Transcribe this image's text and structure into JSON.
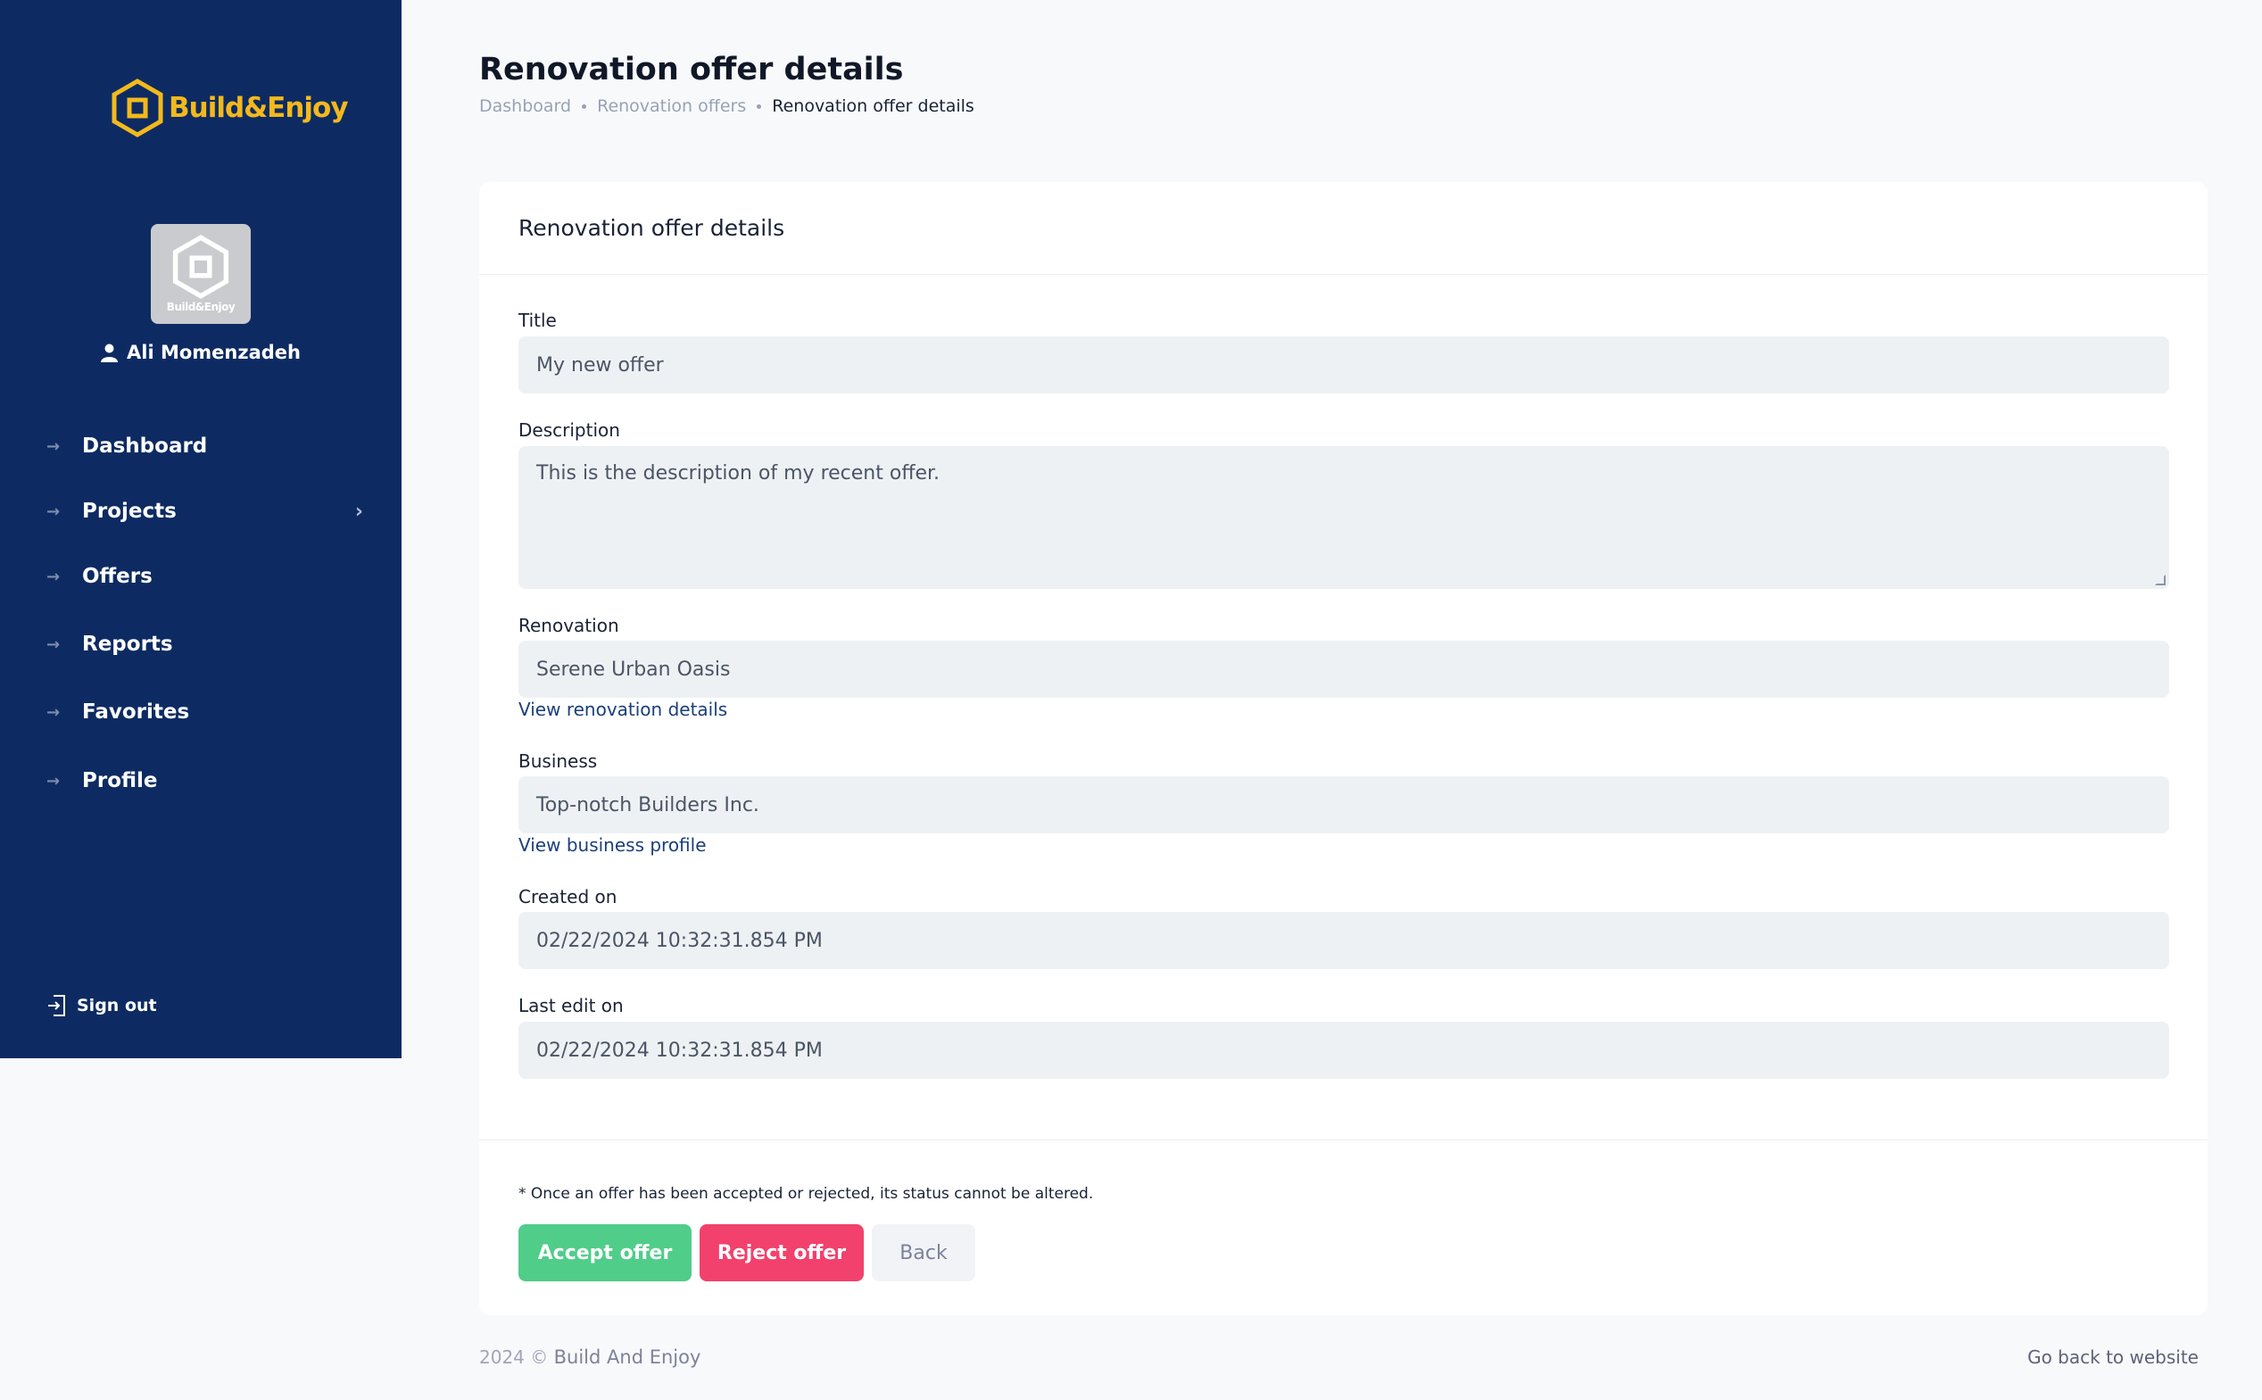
{
  "brand": {
    "logo_text": "Build&Enjoy",
    "avatar_text": "Build&Enjoy",
    "primary_color": "#0d2b62",
    "logo_color": "#f3b91c"
  },
  "user": {
    "name": "Ali Momenzadeh"
  },
  "nav": {
    "items": [
      {
        "label": "Dashboard"
      },
      {
        "label": "Projects"
      },
      {
        "label": "Offers"
      },
      {
        "label": "Reports"
      },
      {
        "label": "Favorites"
      },
      {
        "label": "Profile"
      }
    ],
    "signout": "Sign out"
  },
  "header": {
    "title": "Renovation offer details",
    "breadcrumb": [
      "Dashboard",
      "Renovation offers",
      "Renovation offer details"
    ]
  },
  "card": {
    "title": "Renovation offer details",
    "fields": {
      "title": {
        "label": "Title",
        "value": "My new offer"
      },
      "description": {
        "label": "Description",
        "value": "This is the description of my recent offer."
      },
      "renovation": {
        "label": "Renovation",
        "value": "Serene Urban Oasis",
        "link": "View renovation details"
      },
      "business": {
        "label": "Business",
        "value": "Top-notch Builders Inc.",
        "link": "View business profile"
      },
      "created": {
        "label": "Created on",
        "value": "02/22/2024 10:32:31.854 PM"
      },
      "last_edit": {
        "label": "Last edit on",
        "value": "02/22/2024 10:32:31.854 PM"
      }
    },
    "note": "* Once an offer has been accepted or rejected, its status cannot be altered.",
    "buttons": {
      "accept": "Accept offer",
      "reject": "Reject offer",
      "back": "Back"
    },
    "colors": {
      "accept": "#50cd89",
      "reject": "#f1416c"
    }
  },
  "footer": {
    "year": "2024 ©",
    "brand": "Build And Enjoy",
    "link": "Go back to website"
  }
}
